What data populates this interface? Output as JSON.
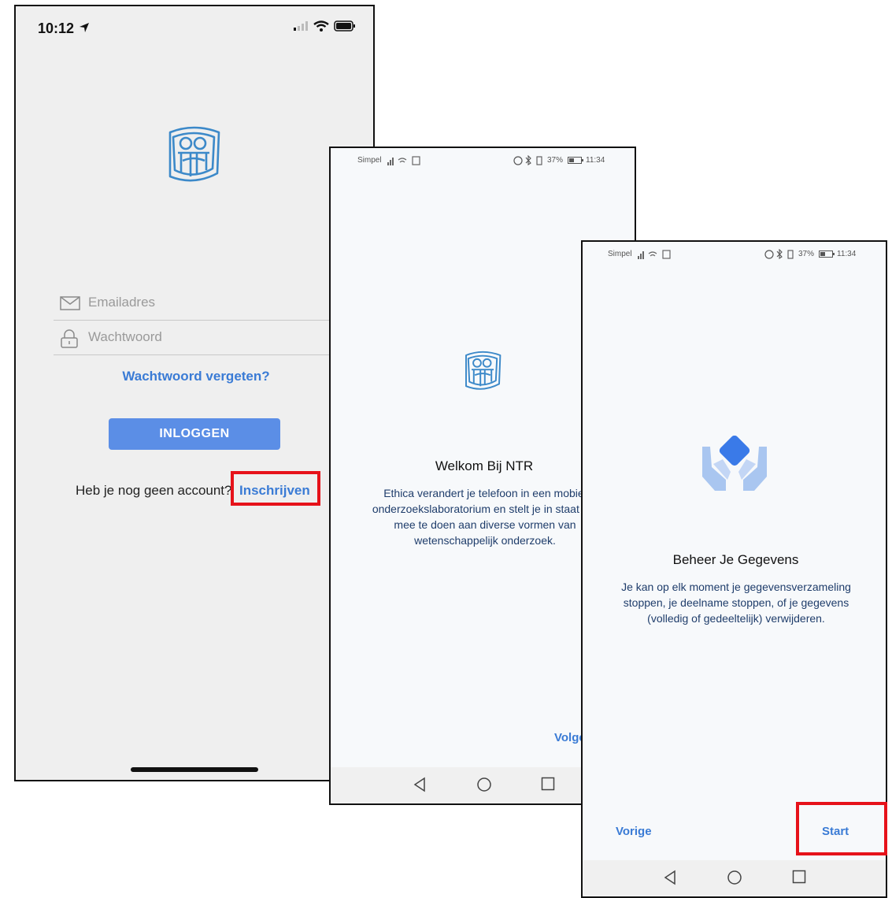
{
  "ios_screen": {
    "status_time": "10:12",
    "email_placeholder": "Emailadres",
    "password_placeholder": "Wachtwoord",
    "forgot_password": "Wachtwoord vergeten?",
    "login_button": "INLOGGEN",
    "no_account_text": "Heb je nog geen account?",
    "signup_link": "Inschrijven"
  },
  "android_welcome": {
    "status_carrier": "Simpel",
    "status_right": "37%",
    "status_time": "11:34",
    "title": "Welkom Bij NTR",
    "body": "Ethica verandert je telefoon in een mobiel onderzoekslaboratorium en stelt je in staat om mee te doen aan diverse vormen van wetenschappelijk onderzoek.",
    "next_button": "Volgende"
  },
  "android_data": {
    "status_carrier": "Simpel",
    "status_right": "37%",
    "status_time": "11:34",
    "title": "Beheer Je Gegevens",
    "body": "Je kan op elk moment je gegevensverzameling stoppen, je deelname stoppen, of je gegevens (volledig of gedeeltelijk) verwijderen.",
    "prev_button": "Vorige",
    "start_button": "Start"
  },
  "colors": {
    "accent": "#3a7bd5",
    "button": "#5b8ee6",
    "highlight": "#e6121a"
  }
}
